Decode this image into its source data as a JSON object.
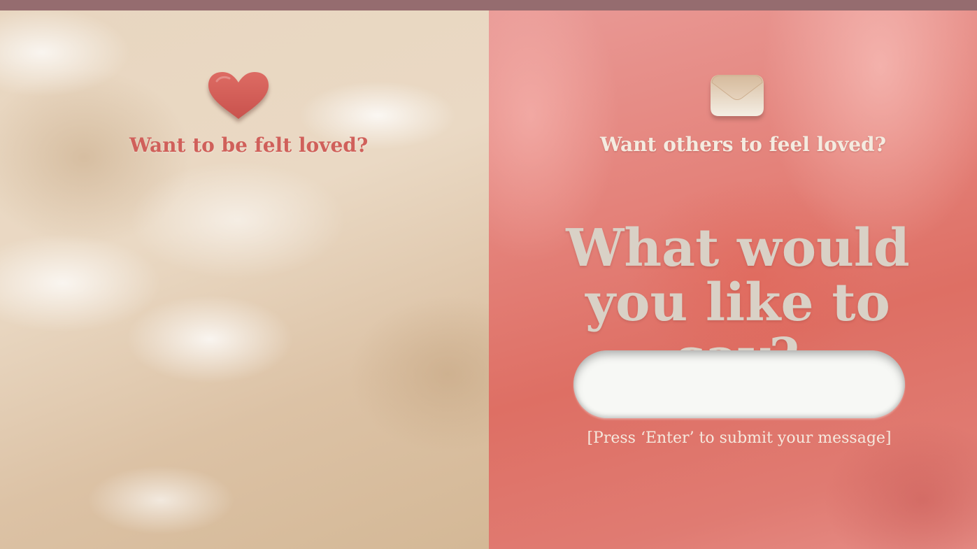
{
  "colors": {
    "top_bar": "#956c6f",
    "left_panel": "#e8d6c0",
    "right_panel": "#e4827a",
    "heart": "#d9625b",
    "envelope": "#d9c3a8",
    "left_question_text": "#d0605a",
    "right_question_text": "#f4ebe0",
    "headline_text": "#d9d1c6",
    "input_background": "#f7f8f5"
  },
  "left_panel": {
    "icon": "heart-icon",
    "question": "Want to be felt loved?"
  },
  "right_panel": {
    "icon": "envelope-icon",
    "question": "Want others to feel loved?",
    "headline_line1": "What would",
    "headline_line2": "you like to say?",
    "message_input": {
      "value": "",
      "placeholder": ""
    },
    "hint": "[Press ‘Enter’ to submit your message]"
  }
}
